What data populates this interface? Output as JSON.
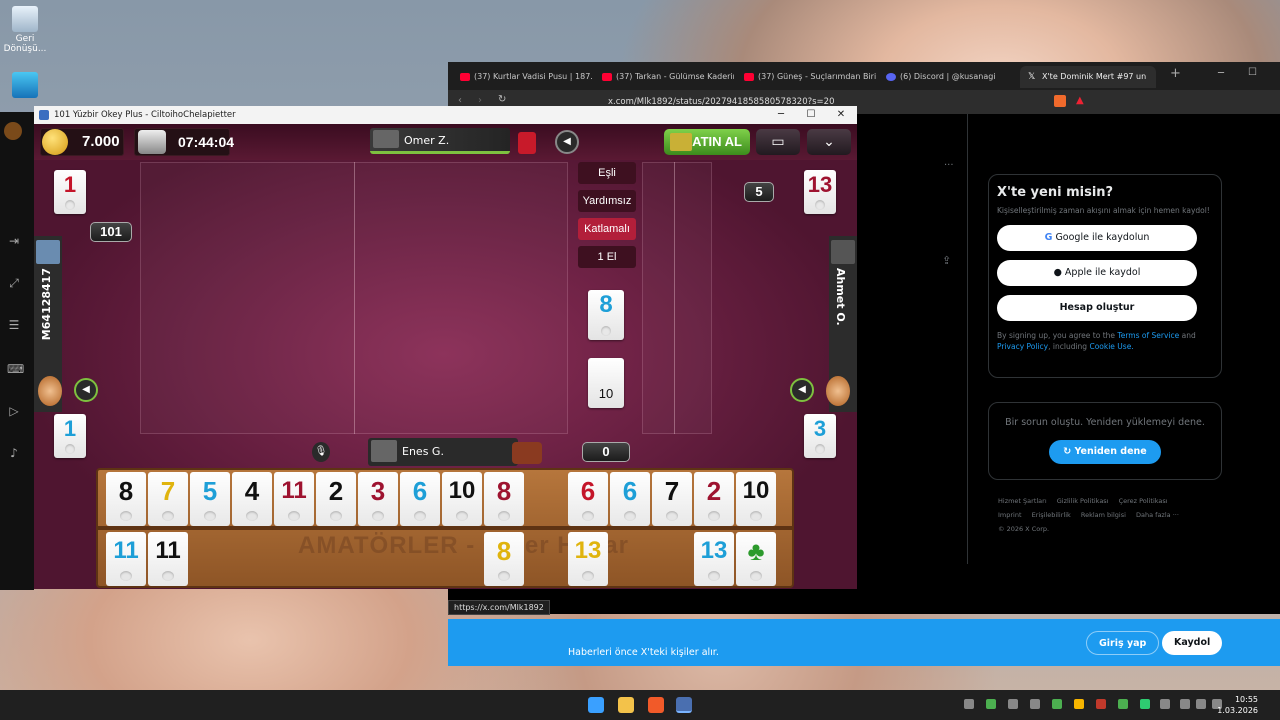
{
  "desktop": {
    "recycle_label": "Geri Dönüşü...",
    "icons": [
      "recycle-bin-icon",
      "monitor-icon"
    ]
  },
  "browser": {
    "tabs": [
      {
        "label": "(37) Kurtlar Vadisi Pusu | 187. B"
      },
      {
        "label": "(37) Tarkan - Gülümse Kaderine"
      },
      {
        "label": "(37) Güneş - Suçlarımdan Biri"
      },
      {
        "label": "(6) Discord | @kusanagi"
      },
      {
        "label": "X'te Dominik Mert #97 un"
      }
    ],
    "url": "x.com/Mlk1892/status/2027941858580578320?s=20",
    "signup": {
      "title": "X'te yeni misin?",
      "subtitle": "Kişiselleştirilmiş zaman akışını almak için hemen kaydol!",
      "google": "Google ile kaydolun",
      "apple": "Apple ile kaydol",
      "create": "Hesap oluştur",
      "terms_pre": "By signing up, you agree to the",
      "tos": "Terms of Service",
      "and": "and",
      "privacy": "Privacy Policy",
      "including": ", including",
      "cookie": "Cookie Use."
    },
    "error": {
      "message": "Bir sorun oluştu. Yeniden yüklemeyi dene.",
      "retry": "Yeniden dene"
    },
    "footer": [
      "Hizmet Şartları",
      "Gizlilik Politikası",
      "Çerez Politikası",
      "Imprint",
      "Erişilebilirlik",
      "Reklam bilgisi",
      "Daha fazla ···",
      "© 2026 X Corp."
    ],
    "bottom_banner": {
      "text": "Haberleri önce X'teki kişiler alır.",
      "login": "Giriş yap",
      "register": "Kaydol"
    },
    "link_tooltip": "https://x.com/Mlk1892"
  },
  "game": {
    "window_title": "101 Yüzbir Okey Plus - CiltoihoChelapietter",
    "coins": "7.000",
    "timer": "07:44:04",
    "top_player": "Omer Z.",
    "buy_label": "SATIN AL",
    "bottom_player": "Enes G.",
    "left_player": "M64128417",
    "right_player": "Ahmet O.",
    "score_left": "101",
    "score_right": "5",
    "score_bottom": "0",
    "options": [
      "Eşli",
      "Yardımsız",
      "Katlamalı",
      "1 El"
    ],
    "indicator_tile": {
      "value": "8",
      "color": "blue"
    },
    "deck_count": "10",
    "discard_tiles": {
      "top_left": {
        "value": "1",
        "color": "red"
      },
      "top_right": {
        "value": "13",
        "color": "maroon"
      },
      "bottom_left": {
        "value": "1",
        "color": "blue"
      },
      "bottom_right": {
        "value": "3",
        "color": "blue"
      }
    },
    "rack_label": "AMATÖRLER - Omer Hasar",
    "rack_row1": [
      {
        "value": "8",
        "color": "black"
      },
      {
        "value": "7",
        "color": "yellow"
      },
      {
        "value": "5",
        "color": "blue"
      },
      {
        "value": "4",
        "color": "black"
      },
      {
        "value": "11",
        "color": "maroon"
      },
      {
        "value": "2",
        "color": "black"
      },
      {
        "value": "3",
        "color": "maroon"
      },
      {
        "value": "6",
        "color": "blue"
      },
      {
        "value": "10",
        "color": "black"
      },
      {
        "value": "8",
        "color": "maroon"
      },
      {
        "value": "6",
        "color": "red"
      },
      {
        "value": "6",
        "color": "blue"
      },
      {
        "value": "7",
        "color": "black"
      },
      {
        "value": "2",
        "color": "maroon"
      },
      {
        "value": "10",
        "color": "black"
      }
    ],
    "rack_row2": [
      {
        "value": "11",
        "color": "blue"
      },
      {
        "value": "11",
        "color": "black"
      },
      {
        "value": "8",
        "color": "yellow"
      },
      {
        "value": "13",
        "color": "yellow"
      },
      {
        "value": "13",
        "color": "blue"
      },
      {
        "value": "♣",
        "color": "green"
      }
    ]
  },
  "taskbar": {
    "time": "10:55",
    "date": "1.03.2026"
  }
}
